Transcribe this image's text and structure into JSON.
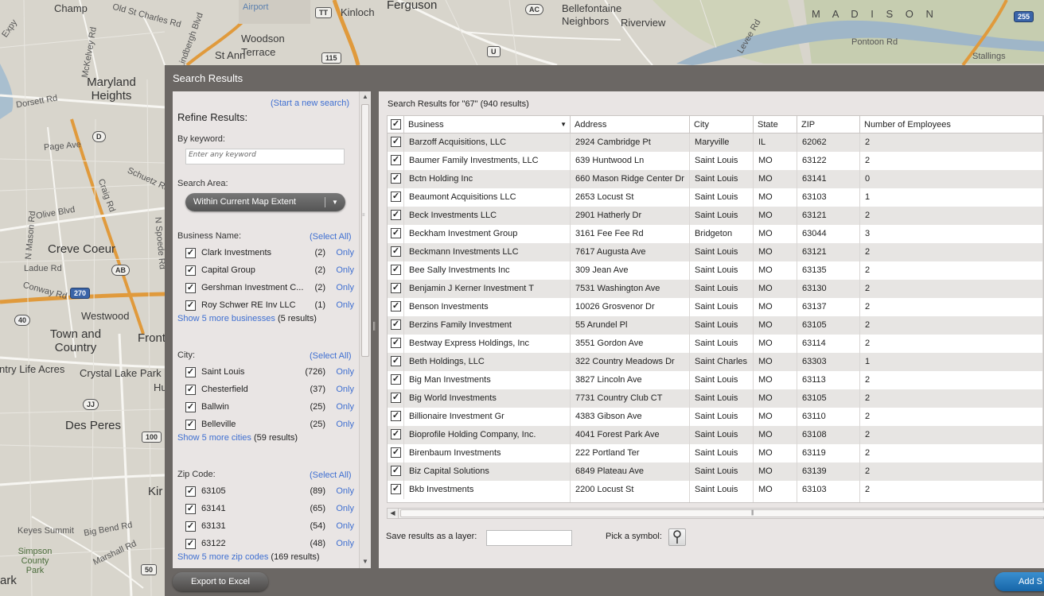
{
  "map": {
    "labels": [
      "Champ",
      "Old St Charles Rd",
      "Airport",
      "TT",
      "Kinloch",
      "Ferguson",
      "AC",
      "Bellefontaine Neighbors",
      "Riverview",
      "M A D I S O N",
      "255",
      "Lindbergh Blvd",
      "Woodson Terrace",
      "St Ann",
      "115",
      "U",
      "Pontoon Rd",
      "Stallings",
      "Maryland Heights",
      "Dorsett Rd",
      "Page Ave",
      "D",
      "Schuetz Rd",
      "Olive Blvd",
      "Craig Rd",
      "N Mason Rd",
      "N Spoede Rd",
      "Creve Coeur",
      "Ladue Rd",
      "AB",
      "Conway Rd",
      "270",
      "Westwood",
      "40",
      "Town and Country",
      "Front",
      "ntry Life Acres",
      "Crystal Lake Park",
      "Hu",
      "JJ",
      "Des Peres",
      "100",
      "Kir",
      "Big Bend Rd",
      "Keyes Summit",
      "Marshall Rd",
      "Simpson County Park",
      "50",
      "ark",
      "Levee Rd",
      "Expy",
      "McKelvey Rd"
    ]
  },
  "dialog": {
    "title": "Search Results"
  },
  "refine": {
    "start_new": "(Start a new search)",
    "heading": "Refine Results:",
    "keyword_label": "By keyword:",
    "keyword_placeholder": "Enter any keyword",
    "area_label": "Search Area:",
    "area_value": "Within Current Map Extent",
    "business": {
      "label": "Business Name:",
      "select_all": "(Select All)",
      "items": [
        {
          "name": "Clark Investments",
          "count": "(2)",
          "only": "Only"
        },
        {
          "name": "Capital Group",
          "count": "(2)",
          "only": "Only"
        },
        {
          "name": "Gershman Investment C...",
          "count": "(2)",
          "only": "Only"
        },
        {
          "name": "Roy Schwer RE Inv LLC",
          "count": "(1)",
          "only": "Only"
        }
      ],
      "more_link": "Show 5 more businesses",
      "more_count": "(5 results)"
    },
    "city": {
      "label": "City:",
      "select_all": "(Select All)",
      "items": [
        {
          "name": "Saint Louis",
          "count": "(726)",
          "only": "Only"
        },
        {
          "name": "Chesterfield",
          "count": "(37)",
          "only": "Only"
        },
        {
          "name": "Ballwin",
          "count": "(25)",
          "only": "Only"
        },
        {
          "name": "Belleville",
          "count": "(25)",
          "only": "Only"
        }
      ],
      "more_link": "Show 5 more cities",
      "more_count": "(59 results)"
    },
    "zip": {
      "label": "Zip Code:",
      "select_all": "(Select All)",
      "items": [
        {
          "name": "63105",
          "count": "(89)",
          "only": "Only"
        },
        {
          "name": "63141",
          "count": "(65)",
          "only": "Only"
        },
        {
          "name": "63131",
          "count": "(54)",
          "only": "Only"
        },
        {
          "name": "63122",
          "count": "(48)",
          "only": "Only"
        }
      ],
      "more_link": "Show 5 more zip codes",
      "more_count": "(169 results)"
    }
  },
  "results": {
    "heading": "Search Results for \"67\" (940 results)",
    "columns": [
      "Business",
      "Address",
      "City",
      "State",
      "ZIP",
      "Number of Employees"
    ],
    "rows": [
      [
        "Barzoff Acquisitions, LLC",
        "2924 Cambridge Pt",
        "Maryville",
        "IL",
        "62062",
        "2"
      ],
      [
        "Baumer Family Investments, LLC",
        "639 Huntwood Ln",
        "Saint Louis",
        "MO",
        "63122",
        "2"
      ],
      [
        "Bctn Holding Inc",
        "660 Mason Ridge Center Dr",
        "Saint Louis",
        "MO",
        "63141",
        "0"
      ],
      [
        "Beaumont Acquisitions LLC",
        "2653 Locust St",
        "Saint Louis",
        "MO",
        "63103",
        "1"
      ],
      [
        "Beck Investments LLC",
        "2901 Hatherly Dr",
        "Saint Louis",
        "MO",
        "63121",
        "2"
      ],
      [
        "Beckham Investment Group",
        "3161 Fee Fee Rd",
        "Bridgeton",
        "MO",
        "63044",
        "3"
      ],
      [
        "Beckmann Investments LLC",
        "7617 Augusta Ave",
        "Saint Louis",
        "MO",
        "63121",
        "2"
      ],
      [
        "Bee Sally Investments Inc",
        "309 Jean Ave",
        "Saint Louis",
        "MO",
        "63135",
        "2"
      ],
      [
        "Benjamin J Kerner Investment T",
        "7531 Washington Ave",
        "Saint Louis",
        "MO",
        "63130",
        "2"
      ],
      [
        "Benson Investments",
        "10026 Grosvenor Dr",
        "Saint Louis",
        "MO",
        "63137",
        "2"
      ],
      [
        "Berzins Family Investment",
        "55 Arundel Pl",
        "Saint Louis",
        "MO",
        "63105",
        "2"
      ],
      [
        "Bestway Express Holdings, Inc",
        "3551 Gordon Ave",
        "Saint Louis",
        "MO",
        "63114",
        "2"
      ],
      [
        "Beth Holdings, LLC",
        "322 Country Meadows Dr",
        "Saint Charles",
        "MO",
        "63303",
        "1"
      ],
      [
        "Big Man Investments",
        "3827 Lincoln Ave",
        "Saint Louis",
        "MO",
        "63113",
        "2"
      ],
      [
        "Big World Investments",
        "7731 Country Club CT",
        "Saint Louis",
        "MO",
        "63105",
        "2"
      ],
      [
        "Billionaire Investment Gr",
        "4383 Gibson Ave",
        "Saint Louis",
        "MO",
        "63110",
        "2"
      ],
      [
        "Bioprofile Holding Company, Inc.",
        "4041 Forest Park Ave",
        "Saint Louis",
        "MO",
        "63108",
        "2"
      ],
      [
        "Birenbaum Investments",
        "222 Portland Ter",
        "Saint Louis",
        "MO",
        "63119",
        "2"
      ],
      [
        "Biz Capital Solutions",
        "6849 Plateau Ave",
        "Saint Louis",
        "MO",
        "63139",
        "2"
      ],
      [
        "Bkb Investments",
        "2200 Locust St",
        "Saint Louis",
        "MO",
        "63103",
        "2"
      ]
    ],
    "save_label": "Save results as a layer:",
    "pick_label": "Pick a symbol:"
  },
  "buttons": {
    "export": "Export to Excel",
    "add": "Add S"
  },
  "colors": {
    "dialog_bg": "#6b6764",
    "panel_bg": "#e9e5e4",
    "link": "#3f6fd1",
    "add_button": "#1f74b9"
  },
  "icons": {
    "checkbox": "checkmark",
    "pin": "map-pin-icon"
  }
}
